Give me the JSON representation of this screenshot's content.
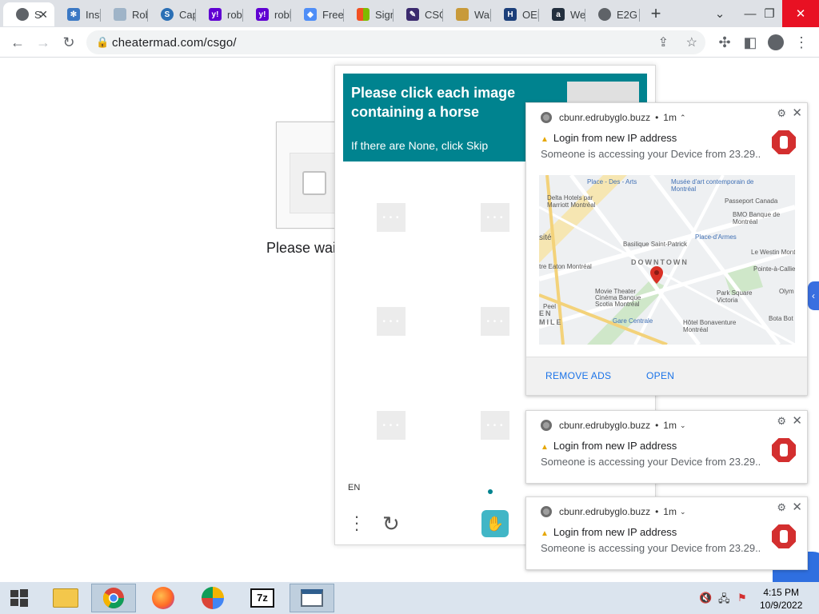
{
  "tabs": [
    {
      "label": "S",
      "icon": "globe-icon",
      "color": "#5f6368",
      "active": true
    },
    {
      "label": "Inst",
      "icon": "snowflake-icon",
      "color": "#3b78c4"
    },
    {
      "label": "Rob",
      "icon": "page-icon",
      "color": "#9fb4c8"
    },
    {
      "label": "Cap",
      "icon": "s-logo-icon",
      "color": "#2a6fb5"
    },
    {
      "label": "robl",
      "icon": "yahoo-icon",
      "color": "#6001d2"
    },
    {
      "label": "robl",
      "icon": "yahoo-icon",
      "color": "#6001d2"
    },
    {
      "label": "Free",
      "icon": "shield-icon",
      "color": "#4f8ef7"
    },
    {
      "label": "Sign",
      "icon": "microsoft-icon",
      "color": "#f25022"
    },
    {
      "label": "CSG",
      "icon": "csgo-icon",
      "color": "#3b2a6e"
    },
    {
      "label": "Wal",
      "icon": "cat-icon",
      "color": "#c89a3a"
    },
    {
      "label": "OEM",
      "icon": "hyundai-icon",
      "color": "#1c3f7a"
    },
    {
      "label": "We",
      "icon": "amazon-icon",
      "color": "#232f3e"
    },
    {
      "label": "E2G",
      "icon": "globe-icon",
      "color": "#5f6368"
    }
  ],
  "toolbar": {
    "url": "cheatermad.com/csgo/"
  },
  "page": {
    "please_wait": "Please wai"
  },
  "challenge": {
    "prompt_title": "Please click each image containing a horse",
    "prompt_sub": "If there are None, click Skip",
    "language": "EN",
    "cell_dots": "• • •"
  },
  "notifications": [
    {
      "origin": "cbunr.edrubyglo.buzz",
      "time": "1m",
      "title": "Login from new IP address",
      "body": "Someone is accessing your Device from 23.29..",
      "expanded": true,
      "remove_ads": "REMOVE ADS",
      "open": "OPEN"
    },
    {
      "origin": "cbunr.edrubyglo.buzz",
      "time": "1m",
      "title": "Login from new IP address",
      "body": "Someone is accessing your Device from 23.29..",
      "expanded": false
    },
    {
      "origin": "cbunr.edrubyglo.buzz",
      "time": "1m",
      "title": "Login from new IP address",
      "body": "Someone is accessing your Device from 23.29..",
      "expanded": false
    }
  ],
  "map": {
    "labels": [
      "Place - Des - Arts",
      "Musée d'art contemporain de Montréal",
      "Delta Hotels par Marriott Montréal",
      "Passeport Canada",
      "BMO Banque de Montréal",
      "Place-d'Armes",
      "sité",
      "Basilique Saint-Patrick",
      "DOWNTOWN",
      "Le Westin Mont",
      "tre Eaton Montréal",
      "Pointe-à-Callie",
      "Movie Theater",
      "Cinéma Banque Scotia Montréal",
      "Park Square Victoria",
      "Peel",
      "EN",
      "MILE",
      "Gare Centrale",
      "Hôtel Bonaventure Montréal",
      "Bota Bot",
      "Olym"
    ]
  },
  "taskbar": {
    "time": "4:15 PM",
    "date": "10/9/2022"
  },
  "colors": {
    "challenge_teal": "#00838f",
    "link_blue": "#1a73e8",
    "stop_red": "#d32f2f"
  }
}
